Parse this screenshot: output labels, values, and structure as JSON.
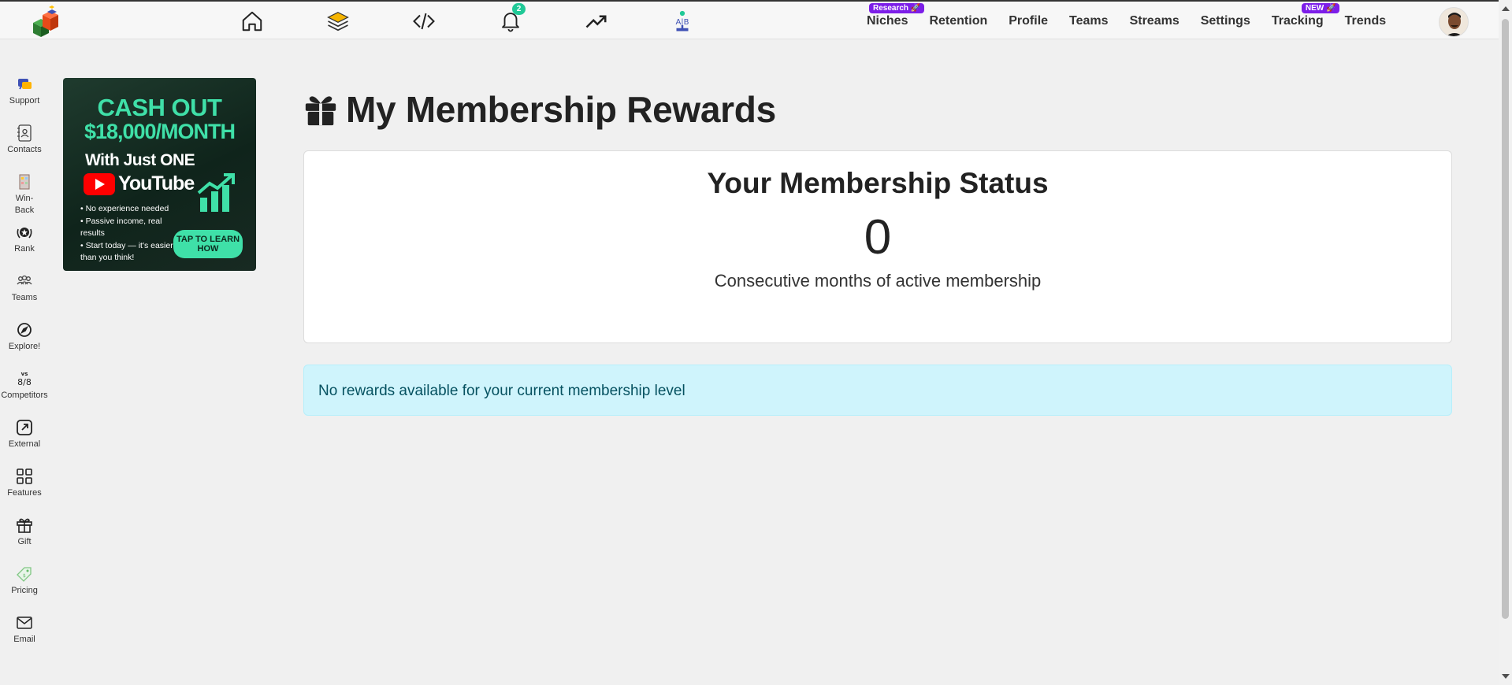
{
  "topnav": {
    "notification_count": "2",
    "links": [
      {
        "label": "Niches",
        "badge": "Research 🚀"
      },
      {
        "label": "Retention",
        "badge": ""
      },
      {
        "label": "Profile",
        "badge": ""
      },
      {
        "label": "Teams",
        "badge": ""
      },
      {
        "label": "Streams",
        "badge": ""
      },
      {
        "label": "Settings",
        "badge": ""
      },
      {
        "label": "Tracking",
        "badge": "NEW 🚀"
      },
      {
        "label": "Trends",
        "badge": ""
      }
    ],
    "ab_icon_text": "A|B"
  },
  "sidebar": {
    "items": [
      {
        "label": "Support",
        "icon": "support-icon"
      },
      {
        "label": "Contacts",
        "icon": "contacts-icon"
      },
      {
        "label": "Win-\nBack",
        "icon": "winback-icon"
      },
      {
        "label": "Rank",
        "icon": "rank-icon"
      },
      {
        "label": "Teams",
        "icon": "teams-icon"
      },
      {
        "label": "Explore!",
        "icon": "compass-icon"
      },
      {
        "label": "Competitors",
        "icon": "versus-icon"
      },
      {
        "label": "External",
        "icon": "external-link-icon"
      },
      {
        "label": "Features",
        "icon": "grid-icon"
      },
      {
        "label": "Gift",
        "icon": "gift-icon"
      },
      {
        "label": "Pricing",
        "icon": "price-tag-icon"
      },
      {
        "label": "Email",
        "icon": "email-icon"
      }
    ]
  },
  "ad": {
    "headline_1": "CASH OUT",
    "headline_2": "$18,000/MONTH",
    "headline_3": "With Just ONE",
    "brand": "YouTube",
    "bullets": [
      "No experience needed",
      "Passive income, real results",
      "Start today — it's easier than you think!"
    ],
    "cta": "TAP TO LEARN HOW"
  },
  "main": {
    "title": "My Membership Rewards",
    "status_card": {
      "title": "Your Membership Status",
      "value": "0",
      "description": "Consecutive months of active membership"
    },
    "alert": "No rewards available for your current membership level"
  },
  "colors": {
    "alert_bg": "#cff4fc",
    "alert_text": "#055160",
    "ad_accent": "#3fe0a8",
    "badge_purple": "#7c1ee8",
    "notif_badge": "#20c997"
  }
}
